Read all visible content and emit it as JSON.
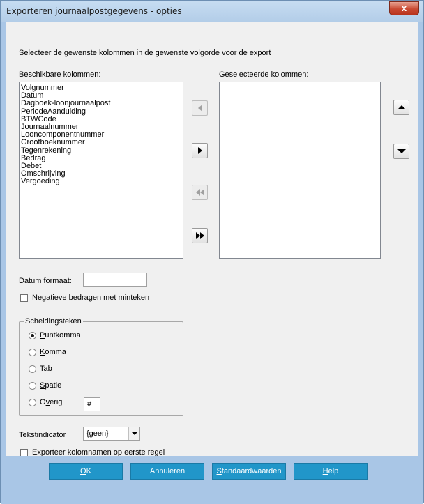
{
  "window": {
    "title": "Exporteren journaalpostgegevens - opties",
    "close_glyph": "x"
  },
  "instruction": "Selecteer de gewenste kolommen in de gewenste volgorde voor de export",
  "available": {
    "label": "Beschikbare kolommen:",
    "items": [
      "Volgnummer",
      "Datum",
      "Dagboek-loonjournaalpost",
      "PeriodeAanduiding",
      "BTWCode",
      "Journaalnummer",
      "Looncomponentnummer",
      "Grootboeknummer",
      "Tegenrekening",
      "Bedrag",
      "Debet",
      "Omschrijving",
      "Vergoeding"
    ]
  },
  "selected": {
    "label": "Geselecteerde kolommen:",
    "items": []
  },
  "date_format": {
    "label": "Datum formaat:",
    "value": ""
  },
  "negative_minus": {
    "label": "Negatieve bedragen met minteken",
    "checked": false
  },
  "separator": {
    "title": "Scheidingsteken",
    "options": [
      {
        "pre": "",
        "accel": "P",
        "post": "untkomma",
        "checked": true
      },
      {
        "pre": "",
        "accel": "K",
        "post": "omma",
        "checked": false
      },
      {
        "pre": "",
        "accel": "T",
        "post": "ab",
        "checked": false
      },
      {
        "pre": "",
        "accel": "S",
        "post": "patie",
        "checked": false
      },
      {
        "pre": "O",
        "accel": "v",
        "post": "erig",
        "checked": false
      }
    ],
    "other_value": "#"
  },
  "text_indicator": {
    "label": "Tekstindicator",
    "value": "{geen}"
  },
  "export_headers": {
    "label": "Exporteer kolomnamen op eerste regel",
    "checked": false
  },
  "buttons": {
    "ok": {
      "pre": "",
      "accel": "O",
      "post": "K"
    },
    "cancel": "Annuleren",
    "defaults": {
      "pre": "",
      "accel": "S",
      "post": "tandaardwaarden"
    },
    "help": {
      "pre": "",
      "accel": "H",
      "post": "elp"
    }
  }
}
